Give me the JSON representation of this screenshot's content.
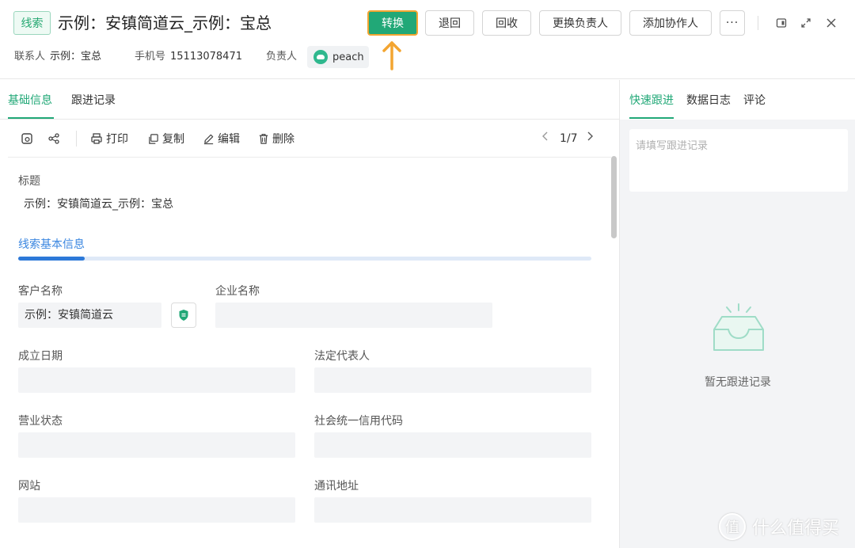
{
  "header": {
    "tag": "线索",
    "title": "示例：安镇简道云_示例：宝总",
    "buttons": {
      "convert": "转换",
      "return": "退回",
      "recycle": "回收",
      "change_owner": "更换负责人",
      "add_collaborator": "添加协作人",
      "more": "···"
    },
    "meta": {
      "contact_label": "联系人",
      "contact_value": "示例：宝总",
      "phone_label": "手机号",
      "phone_value": "15113078471",
      "owner_label": "负责人",
      "owner_value": "peach"
    },
    "colors": {
      "accent": "#21a877",
      "highlight": "#f3a531",
      "link": "#3a86e0"
    }
  },
  "left": {
    "tabs": [
      "基础信息",
      "跟进记录"
    ],
    "toolbar": {
      "print": "打印",
      "copy": "复制",
      "edit": "编辑",
      "delete": "删除",
      "page": "1/7"
    },
    "title_label": "标题",
    "title_value": "示例：安镇简道云_示例：宝总",
    "section_title": "线索基本信息",
    "fields": {
      "customer_name_label": "客户名称",
      "customer_name_value": "示例：安镇简道云",
      "company_name_label": "企业名称",
      "established_label": "成立日期",
      "legal_rep_label": "法定代表人",
      "business_status_label": "营业状态",
      "credit_code_label": "社会统一信用代码",
      "website_label": "网站",
      "address_label": "通讯地址"
    }
  },
  "right": {
    "tabs": [
      "快速跟进",
      "数据日志",
      "评论"
    ],
    "placeholder": "请填写跟进记录",
    "empty_text": "暂无跟进记录"
  },
  "watermark": {
    "circle": "值",
    "text": "什么值得买"
  }
}
